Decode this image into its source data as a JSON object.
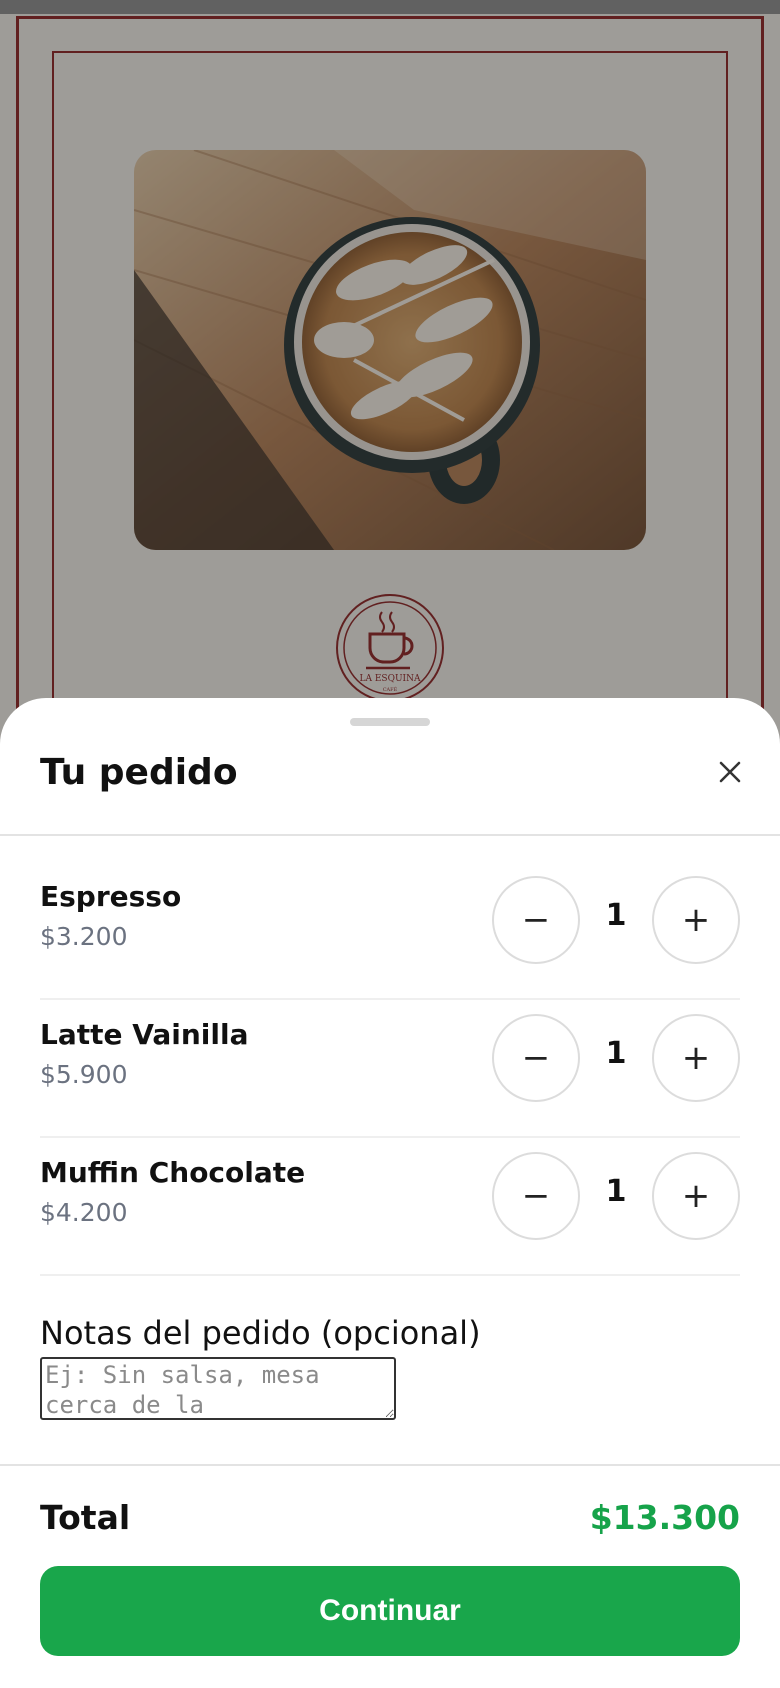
{
  "background": {
    "logo_text": "LA ESQUINA",
    "logo_subtext": "CAFÉ",
    "photo": "latte-art-coffee-cup-on-wooden-table",
    "brand_color": "#8b1a1a"
  },
  "sheet": {
    "title": "Tu pedido",
    "close_icon": "close-icon"
  },
  "items": [
    {
      "name": "Espresso",
      "price": "$3.200",
      "qty": "1",
      "minus": "−",
      "plus": "+"
    },
    {
      "name": "Latte Vainilla",
      "price": "$5.900",
      "qty": "1",
      "minus": "−",
      "plus": "+"
    },
    {
      "name": "Muffin Chocolate",
      "price": "$4.200",
      "qty": "1",
      "minus": "−",
      "plus": "+"
    }
  ],
  "notes": {
    "label": "Notas del pedido (opcional)",
    "placeholder": "Ej: Sin salsa, mesa cerca de la",
    "value": ""
  },
  "summary": {
    "total_label": "Total",
    "total_value": "$13.300",
    "total_color": "#16a34a"
  },
  "actions": {
    "continue_label": "Continuar",
    "continue_color": "#19a64b"
  }
}
